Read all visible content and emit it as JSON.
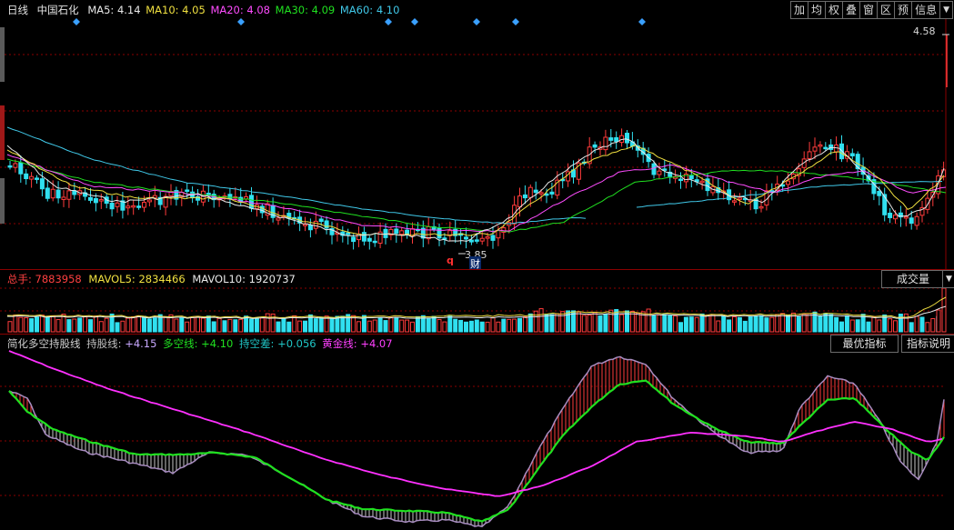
{
  "price_panel": {
    "period_label": "日线",
    "stock_name": "中国石化",
    "ma": [
      {
        "label": "MA5:",
        "value": "4.14",
        "color": "#e8e8e8"
      },
      {
        "label": "MA10:",
        "value": "4.05",
        "color": "#f0e040"
      },
      {
        "label": "MA20:",
        "value": "4.08",
        "color": "#ff4cff"
      },
      {
        "label": "MA30:",
        "value": "4.09",
        "color": "#20e020"
      },
      {
        "label": "MA60:",
        "value": "4.10",
        "color": "#40c8e8"
      }
    ],
    "high_marker": "4.58",
    "low_marker": "3.85",
    "badge_q": "q",
    "badge_cai": "财",
    "toolbar": [
      "加",
      "均",
      "权",
      "叠",
      "窗",
      "区",
      "预",
      "信息",
      "▼"
    ]
  },
  "volume_panel": {
    "items": [
      {
        "label": "总手:",
        "value": "7883958",
        "color": "#ff4040"
      },
      {
        "label": "MAVOL5:",
        "value": "2834466",
        "color": "#f0e040"
      },
      {
        "label": "MAVOL10:",
        "value": "1920737",
        "color": "#e8e8e8"
      }
    ],
    "button": "成交量",
    "dropdown": "▼"
  },
  "indicator_panel": {
    "name": "简化多空持股线",
    "items": [
      {
        "label": "持股线:",
        "value": "+4.15",
        "color": "#d8a0ff",
        "label_color": "#d8a0ff"
      },
      {
        "label": "多空线:",
        "value": "+4.10",
        "color": "#20e020",
        "label_color": "#20e020"
      },
      {
        "label": "持空差:",
        "value": "+0.056",
        "color": "#20c8c8",
        "label_color": "#20c8c8"
      },
      {
        "label": "黄金线:",
        "value": "+4.07",
        "color": "#ff40ff",
        "label_color": "#ff40ff"
      }
    ],
    "button_best": "最优指标",
    "button_explain": "指标说明"
  },
  "colors": {
    "up": "#ff3b3b",
    "down": "#30e0f0",
    "grid": "#8b0000",
    "marker": "#3aa0ff"
  }
}
